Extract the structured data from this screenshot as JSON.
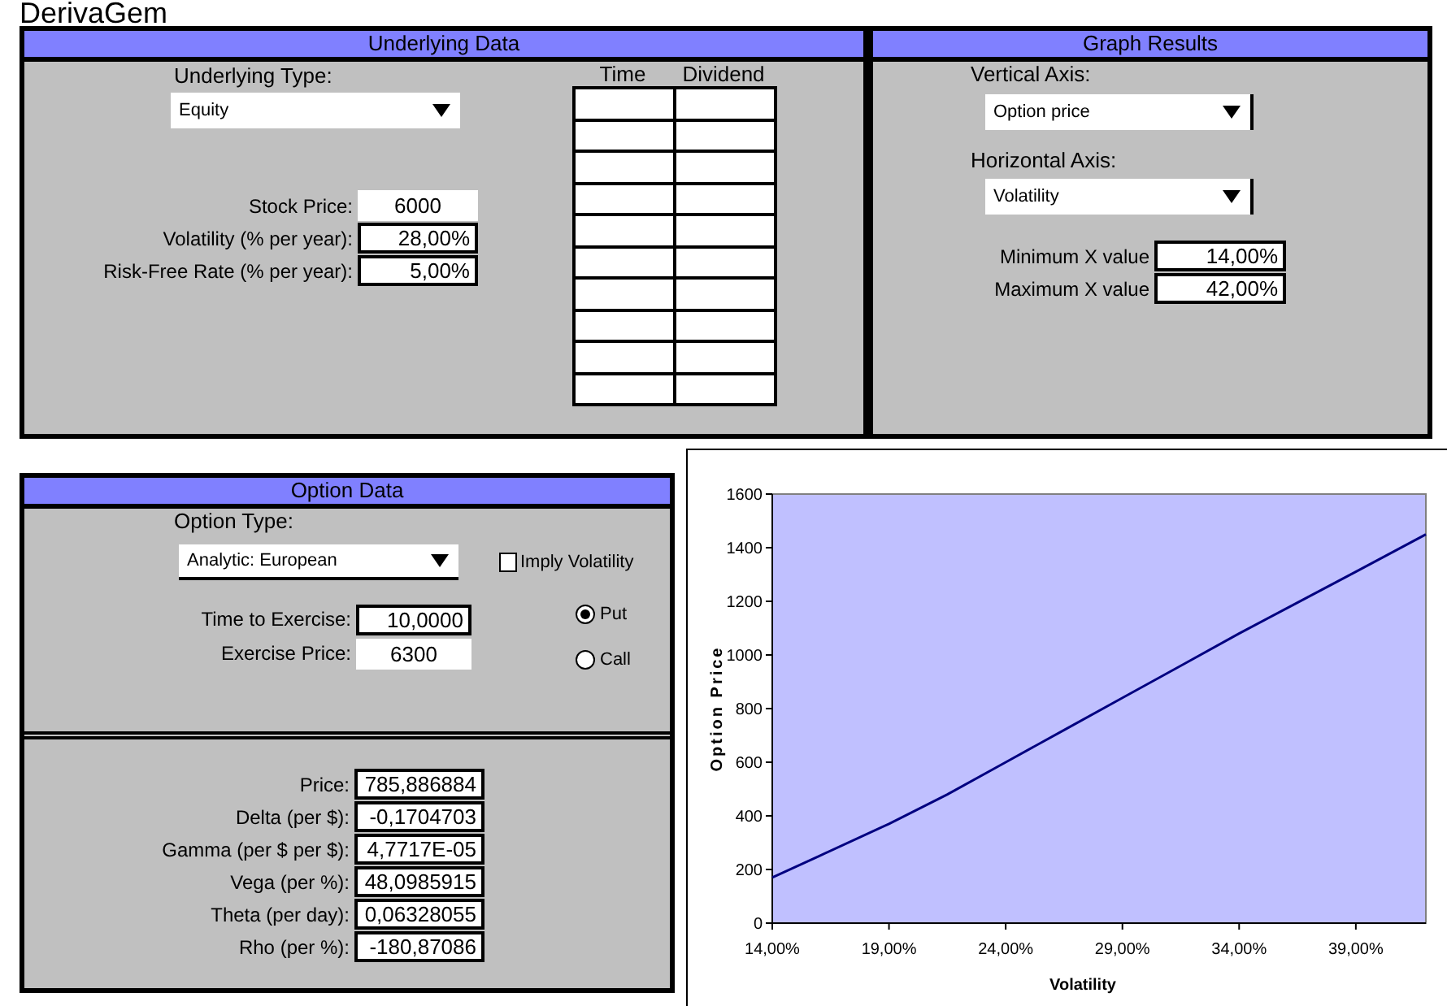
{
  "app_title": "DerivaGem",
  "underlying_data": {
    "title": "Underlying Data",
    "type_label": "Underlying Type:",
    "type_value": "Equity",
    "fields": [
      {
        "label": "Stock Price:",
        "value": "6000",
        "kind": "plain"
      },
      {
        "label": "Volatility (% per year):",
        "value": "28,00%",
        "kind": "framed"
      },
      {
        "label": "Risk-Free Rate (% per year):",
        "value": "5,00%",
        "kind": "framed"
      }
    ],
    "dividend_table": {
      "columns": [
        "Time",
        "Dividend"
      ],
      "rows": [
        {
          "kind": "empty"
        },
        {
          "kind": "empty"
        },
        {
          "kind": "empty"
        },
        {
          "kind": "empty"
        },
        {
          "kind": "empty"
        },
        {
          "kind": "empty"
        },
        {
          "kind": "empty"
        },
        {
          "kind": "empty"
        },
        {
          "kind": "empty"
        },
        {
          "kind": "empty"
        }
      ]
    }
  },
  "graph_results": {
    "title": "Graph Results",
    "vertical_label": "Vertical Axis:",
    "vertical_value": "Option price",
    "horizontal_label": "Horizontal Axis:",
    "horizontal_value": "Volatility",
    "fields": [
      {
        "label": "Minimum X value",
        "value": "14,00%",
        "kind": "framed"
      },
      {
        "label": "Maximum X value",
        "value": "42,00%",
        "kind": "framed"
      }
    ]
  },
  "option_data": {
    "title": "Option Data",
    "type_label": "Option Type:",
    "type_value": "Analytic: European",
    "imply_volatility": {
      "label": "Imply Volatility",
      "checked": false
    },
    "fields": [
      {
        "label": "Time to Exercise:",
        "value": "10,0000",
        "kind": "framed"
      },
      {
        "label": "Exercise Price:",
        "value": "6300",
        "kind": "plain"
      }
    ],
    "options": [
      {
        "label": "Put",
        "selected": true
      },
      {
        "label": "Call",
        "selected": false
      }
    ],
    "results": [
      {
        "label": "Price:",
        "value": "785,886884",
        "kind": "framed"
      },
      {
        "label": "Delta (per $):",
        "value": "-0,1704703",
        "kind": "framed"
      },
      {
        "label": "Gamma (per $ per $):",
        "value": "4,7717E-05",
        "kind": "framed"
      },
      {
        "label": "Vega (per %):",
        "value": "48,0985915",
        "kind": "framed"
      },
      {
        "label": "Theta (per day):",
        "value": "0,06328055",
        "kind": "framed"
      },
      {
        "label": "Rho (per %):",
        "value": "-180,87086",
        "kind": "framed"
      }
    ]
  },
  "graph": {
    "chart_data": {
      "type": "line",
      "xlabel": "Volatility",
      "ylabel": "Option Price",
      "x": [
        14,
        16,
        19,
        21.5,
        24,
        26.5,
        29,
        31.5,
        34,
        36.5,
        39,
        42
      ],
      "series": [
        {
          "color": "#000080",
          "values": [
            170,
            250,
            370,
            480,
            600,
            720,
            840,
            960,
            1080,
            1195,
            1310,
            1450
          ]
        }
      ],
      "xlim": [
        14,
        42
      ],
      "ylim": [
        0,
        1600
      ],
      "xticks": [
        {
          "value": 14,
          "label": "14,00%"
        },
        {
          "value": 19,
          "label": "19,00%"
        },
        {
          "value": 24,
          "label": "24,00%"
        },
        {
          "value": 29,
          "label": "29,00%"
        },
        {
          "value": 34,
          "label": "34,00%"
        },
        {
          "value": 39,
          "label": "39,00%"
        }
      ],
      "yticks": [
        0,
        200,
        400,
        600,
        800,
        1000,
        1200,
        1400,
        1600
      ]
    }
  }
}
